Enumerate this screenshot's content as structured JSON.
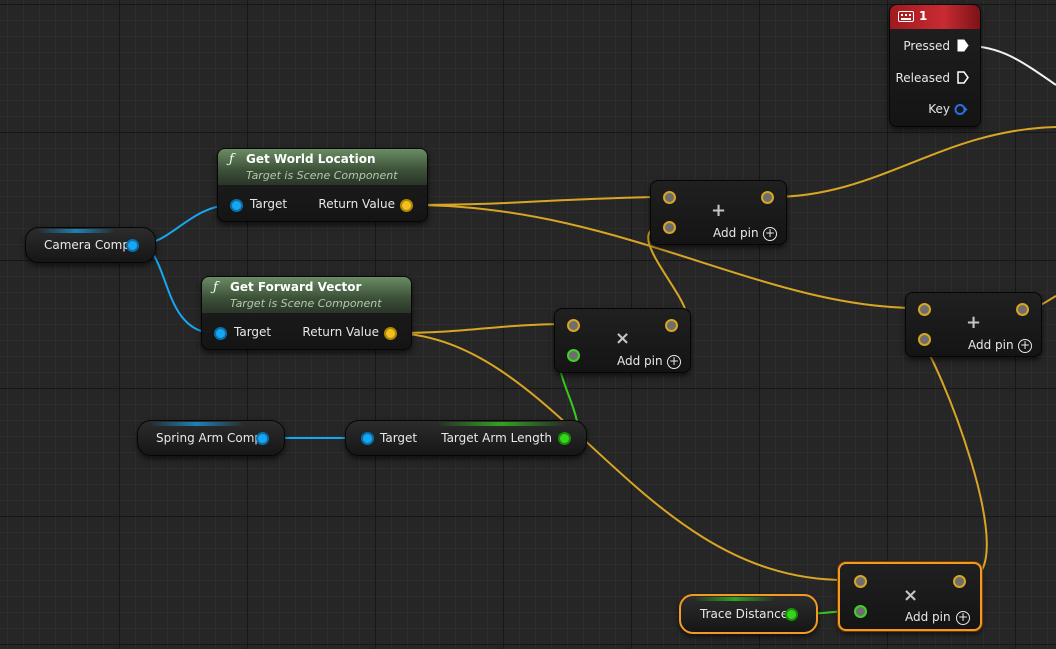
{
  "event_node": {
    "header_label": "1",
    "pins": [
      {
        "label": "Pressed"
      },
      {
        "label": "Released"
      },
      {
        "label": "Key"
      }
    ],
    "header_color": "#b3222a"
  },
  "get_world_location": {
    "title": "Get World Location",
    "subtitle": "Target is Scene Component",
    "input_label": "Target",
    "output_label": "Return Value"
  },
  "get_forward_vector": {
    "title": "Get Forward Vector",
    "subtitle": "Target is Scene Component",
    "input_label": "Target",
    "output_label": "Return Value"
  },
  "camera_comp": {
    "label": "Camera Comp"
  },
  "spring_arm_comp": {
    "label": "Spring Arm Comp"
  },
  "target_arm_length": {
    "input_label": "Target",
    "output_label": "Target Arm Length"
  },
  "trace_distance": {
    "label": "Trace Distance"
  },
  "add_node_1": {
    "symbol": "+",
    "add_pin_label": "Add pin"
  },
  "multiply_node_1": {
    "symbol": "×",
    "add_pin_label": "Add pin"
  },
  "add_node_2": {
    "symbol": "+",
    "add_pin_label": "Add pin"
  },
  "multiply_node_2": {
    "symbol": "×",
    "add_pin_label": "Add pin"
  },
  "colors": {
    "object_pin": "#16a7f2",
    "vector_pin": "#f0c020",
    "float_pin": "#35d51c",
    "selection": "#f29a24",
    "function_header": "#6a8c63"
  }
}
